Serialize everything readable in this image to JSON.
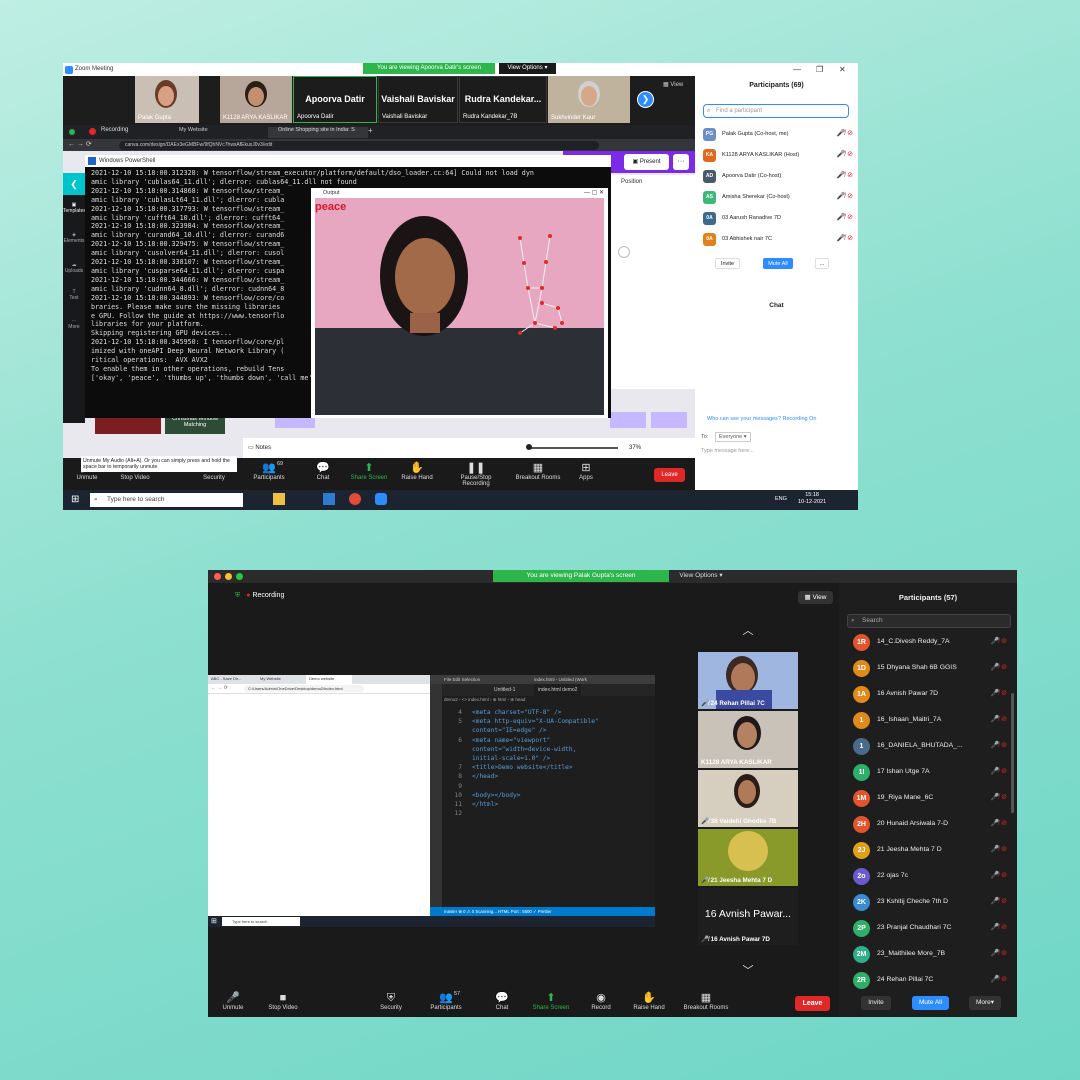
{
  "w1": {
    "title": "Zoom Meeting",
    "viewing_banner": "You are viewing Apoorva Datir's screen",
    "view_options": "View Options ▾",
    "view_btn": "View",
    "tiles": [
      {
        "name": "Palak Gupta"
      },
      {
        "name": "K1128 ARYA KASLIKAR"
      },
      {
        "big": "Apoorva Datir",
        "name": "Apoorva Datir"
      },
      {
        "big": "Vaishali Baviskar",
        "name": "Vaishali Baviskar"
      },
      {
        "big": "Rudra Kandekar...",
        "name": "Rudra Kandekar_7B"
      },
      {
        "name": "Sukhvinder Kaur"
      }
    ],
    "participants_title": "Participants (69)",
    "find_placeholder": "Find a participant",
    "participants": [
      {
        "initials": "PG",
        "name": "Palak Gupta (Co-host, me)",
        "color": "#6a8fc7"
      },
      {
        "initials": "KA",
        "name": "K1128 ARYA KASLIKAR (Host)",
        "color": "#e06a1b"
      },
      {
        "initials": "AD",
        "name": "Apoorva Datir (Co-host)",
        "color": "#4a5a6a"
      },
      {
        "initials": "AS",
        "name": "Amisha Sherekar (Co-host)",
        "color": "#3cb878"
      },
      {
        "initials": "0A",
        "name": "03 Aarush Ranadive 7D",
        "color": "#3b6a8a"
      },
      {
        "initials": "0A",
        "name": "03 Abhishek nair 7C",
        "color": "#e0821b"
      }
    ],
    "invite": "Invite",
    "mute_all": "Mute All",
    "more": "...",
    "chat_title": "Chat",
    "who_can_see": "Who can see your messages? Recording On",
    "to_label": "To:",
    "to_value": "Everyone ▾",
    "type_message": "Type message here...",
    "recording": "Recording",
    "tab_my_website": "My Website",
    "tab_shopping": "Online Shopping site in India: S",
    "url": "canva.com/design/DAEx3eGMBFw/9fQhNVc7hwsAfEkuxJ0v3/edit",
    "ps_title": "Windows PowerShell",
    "output_title": "Output",
    "gesture": "peace",
    "present": "Present",
    "position": "Position",
    "notes": "Notes",
    "zoom_pct": "37%",
    "side_labels": [
      "Templates",
      "Elements",
      "Uploads",
      "Text",
      "More"
    ],
    "ps_lines": [
      "2021-12-10 15:18:00.312328: W tensorflow/stream_executor/platform/default/dso_loader.cc:64] Could not load dyn",
      "amic library 'cublas64_11.dll'; dlerror: cublas64_11.dll not found",
      "2021-12-10 15:18:00.314868: W tensorflow/stream_",
      "amic library 'cublasLt64_11.dll'; dlerror: cubla",
      "2021-12-10 15:18:00.317793: W tensorflow/stream_",
      "amic library 'cufft64_10.dll'; dlerror: cufft64_",
      "2021-12-10 15:18:00.323984: W tensorflow/stream_",
      "amic library 'curand64_10.dll'; dlerror: curand6",
      "2021-12-10 15:18:00.329475: W tensorflow/stream_",
      "amic library 'cusolver64_11.dll'; dlerror: cusol",
      "2021-12-10 15:18:00.338107: W tensorflow/stream_",
      "amic library 'cusparse64_11.dll'; dlerror: cuspa",
      "2021-12-10 15:18:00.344666: W tensorflow/stream_",
      "amic library 'cudnn64_8.dll'; dlerror: cudnn64_8",
      "2021-12-10 15:18:00.344893: W tensorflow/core/co",
      "braries. Please make sure the missing libraries",
      "e GPU. Follow the guide at https://www.tensorflo",
      "libraries for your platform.",
      "Skipping registering GPU devices...",
      "2021-12-10 15:18:00.345950: I tensorflow/core/pl",
      "imized with oneAPI Deep Neural Network Library (",
      "ritical operations:  AVX AVX2",
      "To enable them in other operations, rebuild Tens",
      "['okay', 'peace', 'thumbs up', 'thumbs down', 'call me', 'stop', 'rock', 'live long', 'fist', 'smile']"
    ],
    "unmute_tip": "Unmute My Audio (Alt+A). Or you can simply press and hold the space bar to temporarily unmute",
    "toolbar": [
      {
        "label": "Unmute",
        "icon": "🎤"
      },
      {
        "label": "Stop Video",
        "icon": "■"
      },
      {
        "label": "Security",
        "icon": "⛨"
      },
      {
        "label": "Participants",
        "icon": "👥"
      },
      {
        "label": "Chat",
        "icon": "💬"
      },
      {
        "label": "Share Screen",
        "icon": "⬆"
      },
      {
        "label": "Raise Hand",
        "icon": "✋"
      },
      {
        "label": "Pause/Stop Recording",
        "icon": "❚❚"
      },
      {
        "label": "Breakout Rooms",
        "icon": "▦"
      },
      {
        "label": "Apps",
        "icon": "⊞"
      }
    ],
    "participants_count": "69",
    "leave": "Leave",
    "taskbar_search": "Type here to search",
    "time": "15:18",
    "date": "10-12-2021",
    "lang": "ENG",
    "card_text": "Christmas Window Matching"
  },
  "w2": {
    "viewing_banner": "You are viewing Palak Gupta's screen",
    "view_options": "View Options ▾",
    "recording": "Recording",
    "view_btn": "View",
    "participants_title": "Participants (57)",
    "search_placeholder": "Search",
    "participants": [
      {
        "initials": "1R",
        "name": "14_C.Divesh  Reddy_7A",
        "color": "#e0552b"
      },
      {
        "initials": "1D",
        "name": "15 Dhyana Shah 6B GGIS",
        "color": "#e08a1b"
      },
      {
        "initials": "1A",
        "name": "16 Avnish Pawar 7D",
        "color": "#e08a1b"
      },
      {
        "initials": "1",
        "name": "16_Ishaan_Maitri_7A",
        "color": "#e08a1b"
      },
      {
        "initials": "1",
        "name": "16_DANIELA_BHUTADA_...",
        "color": "#4a6a8a"
      },
      {
        "initials": "1I",
        "name": "17 Ishan Utge 7A",
        "color": "#2fae6a"
      },
      {
        "initials": "1M",
        "name": "19_Riya Mane_6C",
        "color": "#e0552b"
      },
      {
        "initials": "2H",
        "name": "20 Hunaid Arsiwala 7-D",
        "color": "#e0552b"
      },
      {
        "initials": "2J",
        "name": "21 Jeesha Mehta 7 D",
        "color": "#e0a01b"
      },
      {
        "initials": "2o",
        "name": "22 ojas 7c",
        "color": "#6a5acd"
      },
      {
        "initials": "2K",
        "name": "23 Kshitij Cheche 7th D",
        "color": "#3a8ad0"
      },
      {
        "initials": "2P",
        "name": "23 Pranjal Chaudhari 7C",
        "color": "#2fae6a"
      },
      {
        "initials": "2M",
        "name": "23_Maithilee More_7B",
        "color": "#2fae8a"
      },
      {
        "initials": "2R",
        "name": "24 Rehan Pillai 7C",
        "color": "#2fae6a"
      }
    ],
    "invite": "Invite",
    "mute_all": "Mute All",
    "more": "More▾",
    "video_tiles": [
      {
        "name": "24 Rehan Pillai 7C"
      },
      {
        "name": "K1128 ARYA KASLIKAR"
      },
      {
        "name": "38 Vaidehi Ghodke 7B"
      },
      {
        "name": "21 Jeesha Mehta 7 D"
      },
      {
        "big": "16 Avnish Pawar...",
        "name": "16 Avnish Pawar 7D"
      }
    ],
    "toolbar": [
      {
        "label": "Unmute",
        "icon": "🎤"
      },
      {
        "label": "Stop Video",
        "icon": "■"
      },
      {
        "label": "Security",
        "icon": "⛨"
      },
      {
        "label": "Participants",
        "icon": "👥"
      },
      {
        "label": "Chat",
        "icon": "💬"
      },
      {
        "label": "Share Screen",
        "icon": "⬆"
      },
      {
        "label": "Record",
        "icon": "◉"
      },
      {
        "label": "Raise Hand",
        "icon": "✋"
      },
      {
        "label": "Breakout Rooms",
        "icon": "▦"
      }
    ],
    "participants_count": "57",
    "leave": "Leave",
    "vscode_title": "index.html - Untitled (Work",
    "vscode_tabs": [
      "Untitled-1",
      "index.html  demo2"
    ],
    "vscode_menu": [
      "File",
      "Edit",
      "Selection"
    ],
    "breadcrumb": "demo2 › <> index.html › ⊕ html › ⊕ head",
    "code_lines": [
      {
        "n": "4",
        "code": "<meta charset=\"UTF-8\" />"
      },
      {
        "n": "5",
        "code": "<meta http-equiv=\"X-UA-Compatible\""
      },
      {
        "n": "",
        "code": "content=\"IE=edge\" />"
      },
      {
        "n": "6",
        "code": "<meta name=\"viewport\""
      },
      {
        "n": "",
        "code": "content=\"width=device-width,"
      },
      {
        "n": "",
        "code": "initial-scale=1.0\" />"
      },
      {
        "n": "7",
        "code": "<title>Demo website</title>"
      },
      {
        "n": "8",
        "code": "</head>"
      },
      {
        "n": "9",
        "code": ""
      },
      {
        "n": "10",
        "code": "<body></body>"
      },
      {
        "n": "11",
        "code": "</html>"
      },
      {
        "n": "12",
        "code": ""
      }
    ],
    "status_bar": "master  ⊗ 0 ⚠ 0   Scanning...   HTML   Port : 5500   ✓ Prettier",
    "chrome_url": "C:/Users/Admin/OneDrive/Desktop/demo2/index.html",
    "chrome_tabs": [
      "ABC - Save Dir...",
      "My Website",
      "Demo website"
    ],
    "taskbar_search": "Type here to search"
  }
}
